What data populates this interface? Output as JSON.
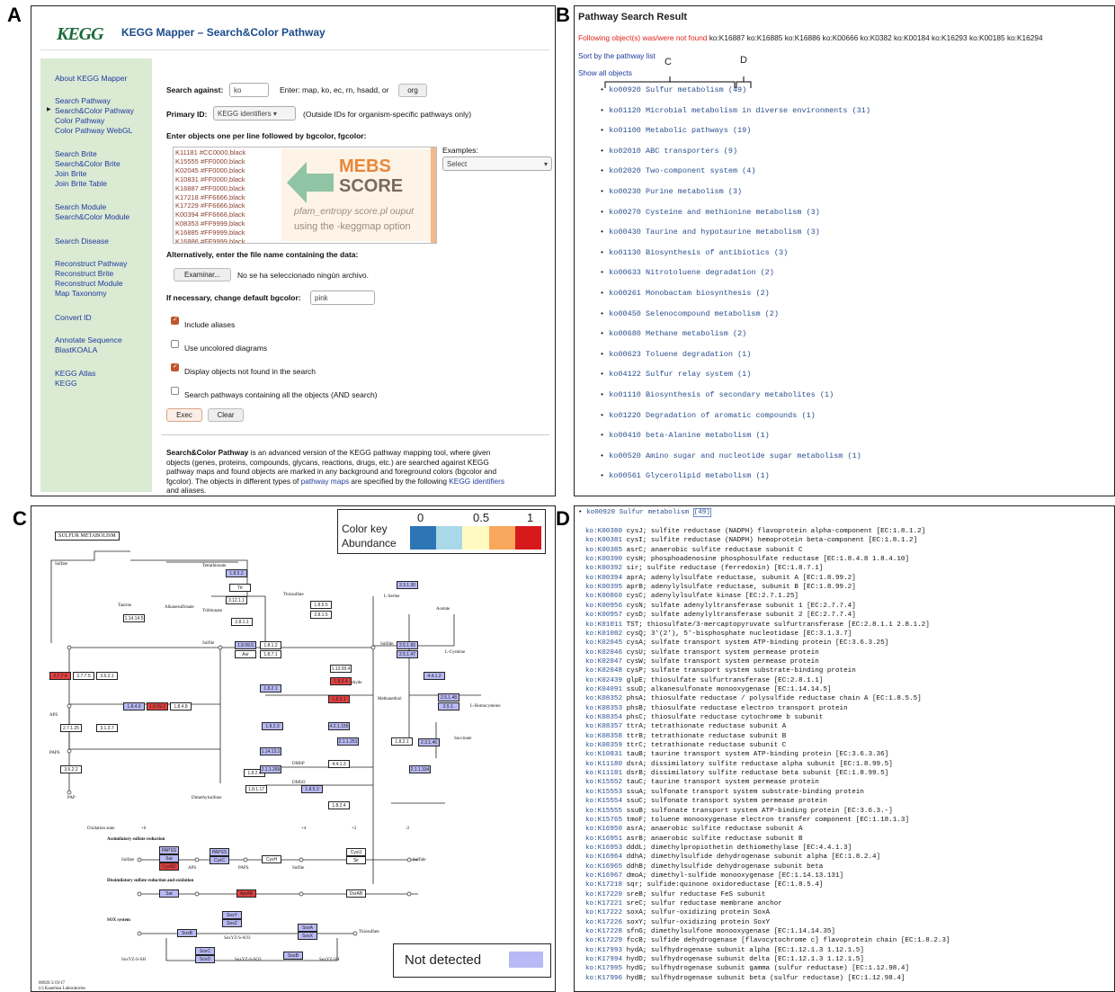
{
  "panel_labels": {
    "a": "A",
    "b": "B",
    "c": "C",
    "d": "D"
  },
  "panelA": {
    "logo": "KEGG",
    "title": "KEGG Mapper – Search&Color Pathway",
    "sidebar": [
      "About KEGG Mapper",
      "Search Pathway",
      "Search&Color Pathway",
      "Color Pathway",
      "Color Pathway WebGL",
      "Search Brite",
      "Search&Color Brite",
      "Join Brite",
      "Join Brite Table",
      "Search Module",
      "Search&Color Module",
      "Search Disease",
      "Reconstruct Pathway",
      "Reconstruct Brite",
      "Reconstruct Module",
      "Map Taxonomy",
      "Convert ID",
      "Annotate Sequence",
      "BlastKOALA",
      "KEGG Atlas",
      "KEGG"
    ],
    "search_against_label": "Search against:",
    "search_against_value": "ko",
    "search_against_hint": "Enter: map, ko, ec, rn, hsadd, or",
    "org_button": "org",
    "primary_id_label": "Primary ID:",
    "primary_id_value": "KEGG identifiers",
    "primary_id_hint": "(Outside IDs for organism-specific pathways only)",
    "enter_objects_label": "Enter objects one per line followed by bgcolor, fgcolor:",
    "textarea_lines": [
      "K11181 #CC0000,black",
      "K15555 #FF0000,black",
      "K02045 #FF0000,black",
      "K10831 #FF0000,black",
      "K16887 #FF0000,black",
      "K17218 #FF6666,black",
      "K17229 #FF6666,black",
      "K00394 #FF6666,black",
      "K08353 #FF9999,black",
      "K16885 #FF9999,black",
      "K16886 #FF9999,black"
    ],
    "overlay_title_1": "MEBS",
    "overlay_title_2": "SCORE",
    "overlay_sub_1": "pfam_entropy score.pl ouput",
    "overlay_sub_2": "using the -keggmap option",
    "examples_label": "Examples:",
    "examples_value": "Select",
    "alt_file_label": "Alternatively, enter the file name containing the data:",
    "browse_button": "Examinar...",
    "no_file_text": "No se ha seleccionado ningún archivo.",
    "bgcolor_label": "If necessary, change default bgcolor:",
    "bgcolor_value": "pink",
    "checkboxes": [
      {
        "label": "Include aliases",
        "checked": true
      },
      {
        "label": "Use uncolored diagrams",
        "checked": false
      },
      {
        "label": "Display objects not found in the search",
        "checked": true
      },
      {
        "label": "Search pathways containing all the objects (AND search)",
        "checked": false
      }
    ],
    "exec_button": "Exec",
    "clear_button": "Clear",
    "desc_bold": "Search&Color Pathway",
    "desc_1": " is an advanced version of the KEGG pathway mapping tool, where given",
    "desc_2": "objects (genes, proteins, compounds, glycans, reactions, drugs, etc.) are searched against KEGG",
    "desc_3": "pathway maps and found objects are marked in any background and foreground colors (bgcolor and",
    "desc_4a": "fgcolor). The objects in different types of ",
    "desc_4link1": "pathway maps",
    "desc_4b": " are specified by the following ",
    "desc_4link2": "KEGG identifiers",
    "desc_5": "and aliases."
  },
  "panelB": {
    "title": "Pathway Search Result",
    "not_found_label": "Following object(s) was/were not found",
    "not_found_ids": "ko:K16887 ko:K16885 ko:K16886 ko:K00666 ko:K0382 ko:K00184 ko:K16293 ko:K00185 ko:K16294",
    "sort_link": "Sort by the pathway list",
    "show_all_link": "Show all objects",
    "annot_c": "C",
    "annot_d": "D",
    "pathways": [
      {
        "id": "ko00920",
        "name": "Sulfur metabolism",
        "count": "(49)"
      },
      {
        "id": "ko01120",
        "name": "Microbial metabolism in diverse environments",
        "count": "(31)"
      },
      {
        "id": "ko01100",
        "name": "Metabolic pathways",
        "count": "(19)"
      },
      {
        "id": "ko02010",
        "name": "ABC transporters",
        "count": "(9)"
      },
      {
        "id": "ko02020",
        "name": "Two-component system",
        "count": "(4)"
      },
      {
        "id": "ko00230",
        "name": "Purine metabolism",
        "count": "(3)"
      },
      {
        "id": "ko00270",
        "name": "Cysteine and methionine metabolism",
        "count": "(3)"
      },
      {
        "id": "ko00430",
        "name": "Taurine and hypotaurine metabolism",
        "count": "(3)"
      },
      {
        "id": "ko01130",
        "name": "Biosynthesis of antibiotics",
        "count": "(3)"
      },
      {
        "id": "ko00633",
        "name": "Nitrotoluene degradation",
        "count": "(2)"
      },
      {
        "id": "ko00261",
        "name": "Monobactam biosynthesis",
        "count": "(2)"
      },
      {
        "id": "ko00450",
        "name": "Selenocompound metabolism",
        "count": "(2)"
      },
      {
        "id": "ko00680",
        "name": "Methane metabolism",
        "count": "(2)"
      },
      {
        "id": "ko00623",
        "name": "Toluene degradation",
        "count": "(1)"
      },
      {
        "id": "ko04122",
        "name": "Sulfur relay system",
        "count": "(1)"
      },
      {
        "id": "ko01110",
        "name": "Biosynthesis of secondary metabolites",
        "count": "(1)"
      },
      {
        "id": "ko01220",
        "name": "Degradation of aromatic compounds",
        "count": "(1)"
      },
      {
        "id": "ko00410",
        "name": "beta-Alanine metabolism",
        "count": "(1)"
      },
      {
        "id": "ko00520",
        "name": "Amino sugar and nucleotide sugar metabolism",
        "count": "(1)"
      },
      {
        "id": "ko00561",
        "name": "Glycerolipid metabolism",
        "count": "(1)"
      }
    ]
  },
  "panelC": {
    "map_title": "SULFUR METABOLISM",
    "colorkey_label_1": "Color key",
    "colorkey_label_2": "Abundance",
    "colorkey_ticks": [
      "0",
      "0.5",
      "1"
    ],
    "colorkey_colors": [
      "#2e75b6",
      "#a9d8e8",
      "#fffbc0",
      "#f7a85c",
      "#d7191c"
    ],
    "not_detected_label": "Not detected",
    "not_detected_color": "#b9b9f5",
    "oxidation_label": "Oxidation state",
    "oxidation_values": [
      "+6",
      "+4",
      "+2",
      "-2"
    ],
    "section_1": "Assimilatory sulfate reduction",
    "section_2": "Dissimilatory sulfate reduction and oxidation",
    "section_3": "SOX system",
    "compounds": [
      "Sulfate",
      "APS",
      "PAPS",
      "Sulfite",
      "Sulfide",
      "Thiosulfate",
      "Tetrathionate",
      "Trithionate",
      "Taurine",
      "Alkanesulfonate",
      "L-Serine",
      "Acetate",
      "L-Cysteine",
      "L-Homocysteine",
      "Succinate",
      "DMSP",
      "DMSO",
      "Methanethiol",
      "Dimethylsulfone",
      "PAP",
      "Acetaldehyde"
    ],
    "enzymes": [
      "1.8.5.2",
      "Ttr",
      "3.12.1.1",
      "2.8.1.1",
      "2.8.1.5",
      "1.8.5.5",
      "1.8.99.5",
      "1.8.1.2",
      "1.8.7.1",
      "Asr",
      "1.13.99.4",
      "1.8.5.4",
      "1.8.3.1",
      "2.3.1.30",
      "2.5.1.65",
      "2.5.1.47",
      "4.4.1.2",
      "2.5.1.48",
      "2.5.1.",
      "2.3.1.46",
      "2.7.7.4",
      "2.7.7.5",
      "3.6.2.1",
      "1.8.4.9",
      "1.8.99.2",
      "1.8.4.8",
      "2.7.1.25",
      "3.1.3.7",
      "3.6.2.2",
      "1.8.2.1",
      "1.14.14.5",
      "1.14.13.1",
      "1.8.2.3",
      "1.8.2.4",
      "4.2.1.155",
      "2.1.1.251",
      "1.8.2.1",
      "4.4.1.3",
      "2.1.1.269",
      "1.8.1.17",
      "1.8.5.3",
      "1.8.2.4",
      "2.1.1.334"
    ],
    "footer_1": "00920 5/19/17",
    "footer_2": "(c) Kanehisa Laboratories",
    "bottom_genes": [
      "PAPSS",
      "Sat",
      "CysND",
      "PAPSS",
      "CysC",
      "CysH",
      "CysIJ",
      "Sir",
      "Sat",
      "AprAB",
      "DsrAB",
      "SoxY",
      "SoxZ",
      "SoxB",
      "SoxA",
      "SoxX",
      "SoxC",
      "SoxD",
      "SoxB"
    ],
    "bottom_compounds": [
      "Sulfate",
      "APS",
      "PAPS",
      "Sulfite",
      "Sulfide",
      "SoxYZ-S-SO3",
      "SoxYZ-S-SH",
      "SoxYZ-S-SO3",
      "SoxYZ-SH",
      "Thiosulfate"
    ]
  },
  "panelD": {
    "header_id": "ko00920",
    "header_name": "Sulfur metabolism",
    "header_count": "(49)",
    "rows": [
      {
        "k": "ko:K00380",
        "d": "cysJ; sulfite reductase (NADPH) flavoprotein alpha-component [EC:1.8.1.2]"
      },
      {
        "k": "ko:K00381",
        "d": "cysI; sulfite reductase (NADPH) hemoprotein beta-component [EC:1.8.1.2]"
      },
      {
        "k": "ko:K00385",
        "d": "asrC; anaerobic sulfite reductase subunit C"
      },
      {
        "k": "ko:K00390",
        "d": "cysH; phosphoadenosine phosphosulfate reductase [EC:1.8.4.8 1.8.4.10]"
      },
      {
        "k": "ko:K00392",
        "d": "sir; sulfite reductase (ferredoxin) [EC:1.8.7.1]"
      },
      {
        "k": "ko:K00394",
        "d": "aprA; adenylylsulfate reductase, subunit A [EC:1.8.99.2]"
      },
      {
        "k": "ko:K00395",
        "d": "aprB; adenylylsulfate reductase, subunit B [EC:1.8.99.2]"
      },
      {
        "k": "ko:K00860",
        "d": "cysC; adenylylsulfate kinase [EC:2.7.1.25]"
      },
      {
        "k": "ko:K00956",
        "d": "cysN; sulfate adenylyltransferase subunit 1 [EC:2.7.7.4]"
      },
      {
        "k": "ko:K00957",
        "d": "cysD; sulfate adenylyltransferase subunit 2 [EC:2.7.7.4]"
      },
      {
        "k": "ko:K01011",
        "d": "TST; thiosulfate/3-mercaptopyruvate sulfurtransferase [EC:2.8.1.1 2.8.1.2]"
      },
      {
        "k": "ko:K01082",
        "d": "cysQ; 3'(2'), 5'-bisphosphate nucleotidase [EC:3.1.3.7]"
      },
      {
        "k": "ko:K02045",
        "d": "cysA; sulfate transport system ATP-binding protein [EC:3.6.3.25]"
      },
      {
        "k": "ko:K02046",
        "d": "cysU; sulfate transport system permease protein"
      },
      {
        "k": "ko:K02047",
        "d": "cysW; sulfate transport system permease protein"
      },
      {
        "k": "ko:K02048",
        "d": "cysP; sulfate transport system substrate-binding protein"
      },
      {
        "k": "ko:K02439",
        "d": "glpE; thiosulfate sulfurtransferase [EC:2.8.1.1]"
      },
      {
        "k": "ko:K04091",
        "d": "ssuD; alkanesulfonate monooxygenase [EC:1.14.14.5]"
      },
      {
        "k": "ko:K08352",
        "d": "phsA; thiosulfate reductase / polysulfide reductase chain A [EC:1.8.5.5]"
      },
      {
        "k": "ko:K08353",
        "d": "phsB; thiosulfate reductase electron transport protein"
      },
      {
        "k": "ko:K08354",
        "d": "phsC; thiosulfate reductase cytochrome b subunit"
      },
      {
        "k": "ko:K08357",
        "d": "ttrA; tetrathionate reductase subunit A"
      },
      {
        "k": "ko:K08358",
        "d": "ttrB; tetrathionate reductase subunit B"
      },
      {
        "k": "ko:K08359",
        "d": "ttrC; tetrathionate reductase subunit C"
      },
      {
        "k": "ko:K10831",
        "d": "tauB; taurine transport system ATP-binding protein [EC:3.6.3.36]"
      },
      {
        "k": "ko:K11180",
        "d": "dsrA; dissimilatory sulfite reductase alpha subunit [EC:1.8.99.5]"
      },
      {
        "k": "ko:K11181",
        "d": "dsrB; dissimilatory sulfite reductase beta subunit [EC:1.8.99.5]"
      },
      {
        "k": "ko:K15552",
        "d": "tauC; taurine transport system permease protein"
      },
      {
        "k": "ko:K15553",
        "d": "ssuA; sulfonate transport system substrate-binding protein"
      },
      {
        "k": "ko:K15554",
        "d": "ssuC; sulfonate transport system permease protein"
      },
      {
        "k": "ko:K15555",
        "d": "ssuB; sulfonate transport system ATP-binding protein [EC:3.6.3.-]"
      },
      {
        "k": "ko:K15765",
        "d": "tmoF; toluene monooxygenase electron transfer component [EC:1.18.1.3]"
      },
      {
        "k": "ko:K16950",
        "d": "asrA; anaerobic sulfite reductase subunit A"
      },
      {
        "k": "ko:K16951",
        "d": "asrB; anaerobic sulfite reductase subunit B"
      },
      {
        "k": "ko:K16953",
        "d": "dddL; dimethylpropiothetin dethiomethylase [EC:4.4.1.3]"
      },
      {
        "k": "ko:K16964",
        "d": "ddhA; dimethylsulfide dehydrogenase subunit alpha [EC:1.8.2.4]"
      },
      {
        "k": "ko:K16965",
        "d": "ddhB; dimethylsulfide dehydrogenase subunit beta"
      },
      {
        "k": "ko:K16967",
        "d": "dmoA; dimethyl-sulfide monooxygenase [EC:1.14.13.131]"
      },
      {
        "k": "ko:K17218",
        "d": "sqr; sulfide:quinone oxidoreductase [EC:1.8.5.4]"
      },
      {
        "k": "ko:K17220",
        "d": "sreB; sulfur reductase FeS subunit"
      },
      {
        "k": "ko:K17221",
        "d": "sreC; sulfur reductase membrane anchor"
      },
      {
        "k": "ko:K17222",
        "d": "soxA; sulfur-oxidizing protein SoxA"
      },
      {
        "k": "ko:K17226",
        "d": "soxY; sulfur-oxidizing protein SoxY"
      },
      {
        "k": "ko:K17228",
        "d": "sfnG; dimethylsulfone monooxygenase [EC:1.14.14.35]"
      },
      {
        "k": "ko:K17229",
        "d": "fccB; sulfide dehydrogenase [flavocytochrome c] flavoprotein chain [EC:1.8.2.3]"
      },
      {
        "k": "ko:K17993",
        "d": "hydA; sulfhydrogenase subunit alpha [EC:1.12.1.3 1.12.1.5]"
      },
      {
        "k": "ko:K17994",
        "d": "hydD; sulfhydrogenase subunit delta [EC:1.12.1.3 1.12.1.5]"
      },
      {
        "k": "ko:K17995",
        "d": "hydG; sulfhydrogenase subunit gamma (sulfur reductase) [EC:1.12.98.4]"
      },
      {
        "k": "ko:K17996",
        "d": "hydB; sulfhydrogenase subunit beta (sulfur reductase) [EC:1.12.98.4]"
      }
    ]
  }
}
